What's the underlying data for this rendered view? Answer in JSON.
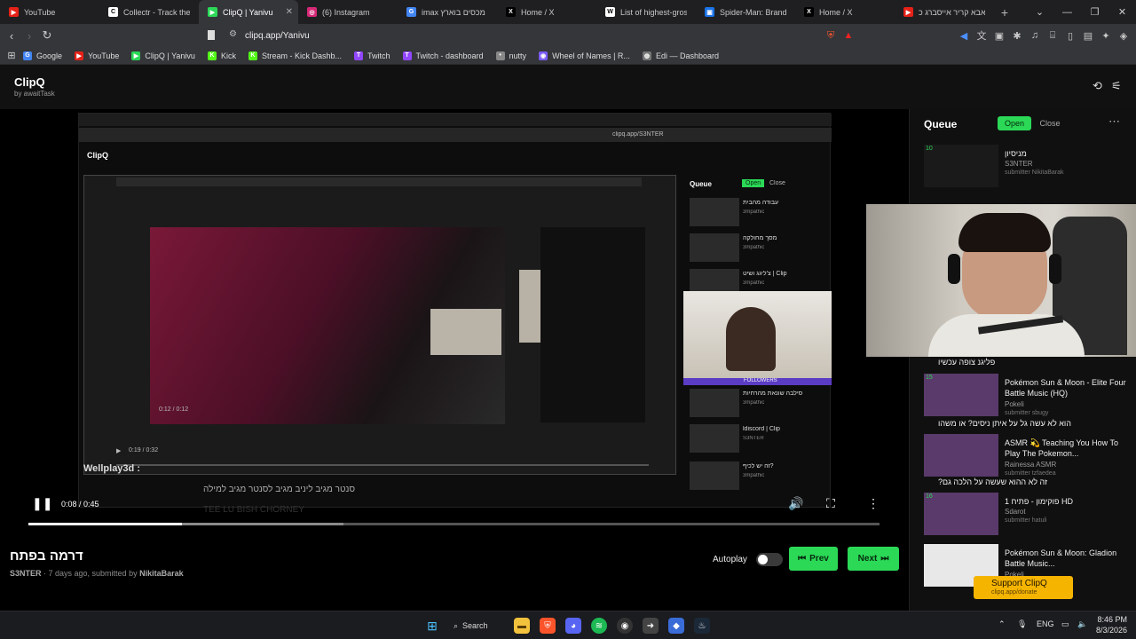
{
  "browser": {
    "tabs": [
      {
        "label": "YouTube",
        "color": "#e62117",
        "glyph": "▶",
        "close": ""
      },
      {
        "label": "Collectr - Track the pr",
        "color": "#ffffff",
        "glyph": "C",
        "close": ""
      },
      {
        "label": "ClipQ | Yanivu",
        "color": "#2bd957",
        "glyph": "▶",
        "close": "✕"
      },
      {
        "label": "(6) Instagram",
        "color": "#d62976",
        "glyph": "◎",
        "close": ""
      },
      {
        "label": "imax דלי מכסים בוארץ",
        "color": "#4285f4",
        "glyph": "G",
        "close": ""
      },
      {
        "label": "Home / X",
        "color": "#000000",
        "glyph": "X",
        "close": ""
      },
      {
        "label": "List of highest-grossin",
        "color": "#ffffff",
        "glyph": "W",
        "close": ""
      },
      {
        "label": "Spider-Man: Brand Ne",
        "color": "#1a73e8",
        "glyph": "▣",
        "close": ""
      },
      {
        "label": "Home / X",
        "color": "#000000",
        "glyph": "X",
        "close": ""
      },
      {
        "label": "אבא קריר אייסברג כ'",
        "color": "#e62117",
        "glyph": "▶",
        "close": ""
      }
    ],
    "new_tab": "+",
    "url": "clipq.app/Yanivu",
    "bookmarks": [
      {
        "label": "Google",
        "color": "#4285f4",
        "glyph": "G"
      },
      {
        "label": "YouTube",
        "color": "#e62117",
        "glyph": "▶"
      },
      {
        "label": "ClipQ | Yanivu",
        "color": "#2bd957",
        "glyph": "▶"
      },
      {
        "label": "Kick",
        "color": "#53fc18",
        "glyph": "K"
      },
      {
        "label": "Stream - Kick Dashb...",
        "color": "#53fc18",
        "glyph": "K"
      },
      {
        "label": "Twitch",
        "color": "#9146ff",
        "glyph": "T"
      },
      {
        "label": "Twitch - dashboard",
        "color": "#9146ff",
        "glyph": "T"
      },
      {
        "label": "nutty",
        "color": "#888888",
        "glyph": "•"
      },
      {
        "label": "Wheel of Names | R...",
        "color": "#7b5cff",
        "glyph": "◉"
      },
      {
        "label": "Edi — Dashboard",
        "color": "#777777",
        "glyph": "◍"
      }
    ]
  },
  "app": {
    "name": "ClipQ",
    "byline": "by awaitTask"
  },
  "player": {
    "time": "0:08 / 0:45",
    "progress": 0.18,
    "buffered": 0.37,
    "nested_overlay_name": "Wellplay3d :",
    "nested_overlay_text": "סנטר מגיב ליניב מגיב לסנטר מגיב למילה",
    "nested_overlay_watermark": "TEE LU BISH CHORNEY"
  },
  "video": {
    "title": "דרמה בפתח",
    "channel": "S3NTER",
    "age": " · 7 days ago, submitted by ",
    "submitter": "NikitaBarak"
  },
  "controls": {
    "autoplay_label": "Autoplay",
    "autoplay_on": false,
    "prev_label": "Prev",
    "next_label": "Next"
  },
  "queue": {
    "title": "Queue",
    "open_label": "Open",
    "close_label": "Close",
    "items": [
      {
        "num": "10",
        "title": "מניסיון",
        "channel": "S3NTER",
        "submitter": "submitter NikitaBarak"
      },
      {
        "num": "15",
        "title": "Pokémon Sun & Moon - Elite Four Battle Music (HQ)",
        "channel": "Pokeli",
        "submitter": "submitter sbugy"
      },
      {
        "num": "",
        "title": "ASMR 💫 Teaching You How To Play The Pokemon...",
        "channel": "Rainessa ASMR",
        "submitter": "submitter tzfaedea"
      },
      {
        "num": "16",
        "title": "פוקימון - פתיח 1 HD",
        "channel": "Sdarot",
        "submitter": "submitter hatuli"
      },
      {
        "num": "",
        "title": "Pokémon Sun & Moon: Gladion Battle Music...",
        "channel": "Pokeli",
        "submitter": ""
      }
    ],
    "chat_lines": [
      "פליגנ צופה עכשיו",
      "הוא לא עשה גל על איתן ניסים? או משהו",
      "זה לא ההוא שעשה על הלכה גם?"
    ],
    "support_label": "Support ClipQ",
    "support_sub": "clipq.app/donate"
  },
  "nested": {
    "logo": "ClipQ",
    "url": "clipq.app/S3NTER",
    "queue_title": "Queue",
    "open_label": "Open",
    "close_label": "Close",
    "time": "0:19 / 0:32",
    "followers_label": "FOLLOWERS",
    "inner_time": "0:12 / 0:12",
    "items": [
      {
        "title": "עבודה מהבית",
        "channel": "3mpathic"
      },
      {
        "title": "מסך מחולקה",
        "channel": "3mpathic"
      },
      {
        "title": "צ'ליגג ושיט | Clip",
        "channel": "3mpathic"
      },
      {
        "title": "סילבה שונאת מהרחיות",
        "channel": "3mpathic"
      },
      {
        "title": "ldiscord | Clip",
        "channel": "S3NTER"
      },
      {
        "title": "זה יש לכיף?",
        "channel": "3mpathic"
      }
    ]
  },
  "taskbar": {
    "search_label": "Search",
    "lang": "ENG",
    "time": "8:46 PM",
    "date": "8/3/2026"
  }
}
